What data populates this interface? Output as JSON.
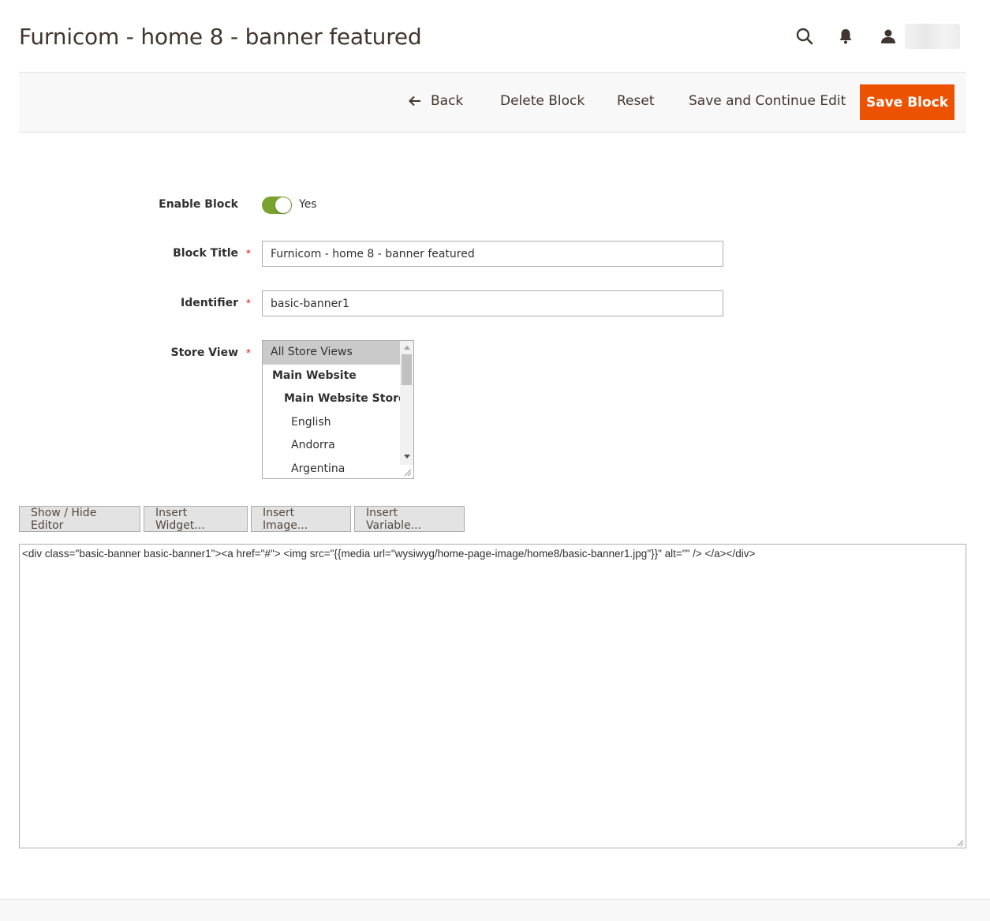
{
  "page": {
    "title": "Furnicom - home 8 - banner featured"
  },
  "header": {
    "icons": [
      "search-icon",
      "bell-icon",
      "user-icon"
    ]
  },
  "actions": {
    "back": "Back",
    "delete": "Delete Block",
    "reset": "Reset",
    "save_continue": "Save and Continue Edit",
    "save": "Save Block"
  },
  "form": {
    "enable_block": {
      "label": "Enable Block",
      "value": "Yes",
      "enabled": true
    },
    "block_title": {
      "label": "Block Title",
      "value": "Furnicom - home 8 - banner featured"
    },
    "identifier": {
      "label": "Identifier",
      "value": "basic-banner1"
    },
    "store_view": {
      "label": "Store View",
      "options": [
        "All Store Views",
        "Main Website",
        "Main Website Store",
        "English",
        "Andorra",
        "Argentina"
      ],
      "selected": "All Store Views"
    },
    "required_mark": "*"
  },
  "editor": {
    "buttons": {
      "show_hide": "Show / Hide Editor",
      "insert_widget": "Insert Widget...",
      "insert_image": "Insert Image...",
      "insert_variable": "Insert Variable..."
    },
    "content": "<div class=\"basic-banner basic-banner1\"><a href=\"#\"> <img src=\"{{media url=\"wysiwyg/home-page-image/home8/basic-banner1.jpg\"}}\" alt=\"\" /> </a></div>"
  },
  "colors": {
    "primary": "#eb5202",
    "toggle_on": "#79a22e",
    "required": "#e22626"
  }
}
